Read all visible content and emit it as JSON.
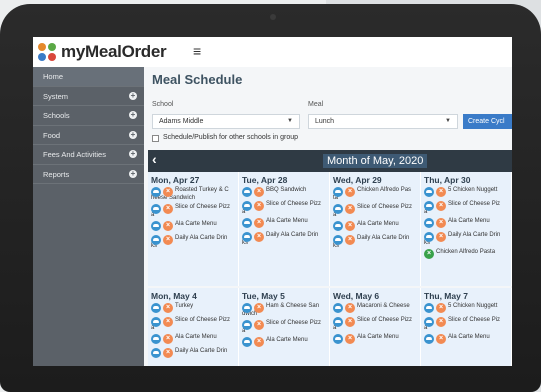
{
  "app": {
    "logo_text": "myMealOrder",
    "hamburger": "≡"
  },
  "sidebar": {
    "items": [
      {
        "label": "Home"
      },
      {
        "label": "System"
      },
      {
        "label": "Schools"
      },
      {
        "label": "Food"
      },
      {
        "label": "Fees And Activities"
      },
      {
        "label": "Reports"
      }
    ]
  },
  "page": {
    "title": "Meal Schedule"
  },
  "filters": {
    "school_label": "School",
    "school_value": "Adams Middle",
    "meal_label": "Meal",
    "meal_value": "Lunch",
    "create_label": "Create Cycl",
    "publish_label": "Schedule/Publish for other schools in group"
  },
  "calendar": {
    "prev": "‹",
    "month": "Month of May, 2020",
    "days": [
      {
        "title": "Mon, Apr 27",
        "meals": [
          {
            "name": "Roasted Turkey & C",
            "tail": "heese Sandwich"
          },
          {
            "name": "Slice of Cheese Pizz",
            "tail": "a"
          },
          {
            "name": "Ala Carte Menu",
            "tail": ""
          },
          {
            "name": "Daily Ala Carte Drin",
            "tail": "ks"
          }
        ]
      },
      {
        "title": "Tue, Apr 28",
        "meals": [
          {
            "name": "BBQ Sandwich",
            "tail": ""
          },
          {
            "name": "Slice of Cheese Pizz",
            "tail": "a"
          },
          {
            "name": "Ala Carte Menu",
            "tail": ""
          },
          {
            "name": "Daily Ala Carte Drin",
            "tail": "ks"
          }
        ]
      },
      {
        "title": "Wed, Apr 29",
        "meals": [
          {
            "name": "Chicken Alfredo Pas",
            "tail": "ta"
          },
          {
            "name": "Slice of Cheese Pizz",
            "tail": "a"
          },
          {
            "name": "Ala Carte Menu",
            "tail": ""
          },
          {
            "name": "Daily Ala Carte Drin",
            "tail": "ks"
          }
        ]
      },
      {
        "title": "Thu, Apr 30",
        "meals": [
          {
            "name": "5 Chicken Nuggett",
            "tail": ""
          },
          {
            "name": "Slice of Cheese Piz",
            "tail": "a"
          },
          {
            "name": "Ala Carte Menu",
            "tail": ""
          },
          {
            "name": "Daily Ala Carte Drin",
            "tail": "ks"
          },
          {
            "name": "Chicken Alfredo Pasta",
            "tail": "",
            "approved": true
          }
        ]
      },
      {
        "title": "Mon, May 4",
        "meals": [
          {
            "name": "Turkey",
            "tail": ""
          },
          {
            "name": "Slice of Cheese Pizz",
            "tail": "a"
          },
          {
            "name": "Ala Carte Menu",
            "tail": ""
          },
          {
            "name": "Daily Ala Carte Drin",
            "tail": ""
          }
        ]
      },
      {
        "title": "Tue, May 5",
        "meals": [
          {
            "name": "Ham & Cheese San",
            "tail": "dwich"
          },
          {
            "name": "Slice of Cheese Pizz",
            "tail": "a"
          },
          {
            "name": "Ala Carte Menu",
            "tail": ""
          }
        ]
      },
      {
        "title": "Wed, May 6",
        "meals": [
          {
            "name": "Macaroni & Cheese",
            "tail": ""
          },
          {
            "name": "Slice of Cheese Pizz",
            "tail": "a"
          },
          {
            "name": "Ala Carte Menu",
            "tail": ""
          }
        ]
      },
      {
        "title": "Thu, May 7",
        "meals": [
          {
            "name": "5 Chicken Nuggett",
            "tail": ""
          },
          {
            "name": "Slice of Cheese Piz",
            "tail": "a"
          },
          {
            "name": "Ala Carte Menu",
            "tail": ""
          }
        ]
      }
    ]
  },
  "colors": {
    "sidebar": "#5b6168",
    "accent": "#3a7bc8",
    "calendar_header": "#2f3a44",
    "cell": "#e8f1fb",
    "cloud_icon": "#3a93cf",
    "remove_icon": "#f28a52",
    "approved_icon": "#39a24a"
  },
  "icons": {
    "cloud": "cloud-upload-icon",
    "remove": "remove-x-icon",
    "approved": "check-icon",
    "plus": "plus-circle-icon"
  }
}
